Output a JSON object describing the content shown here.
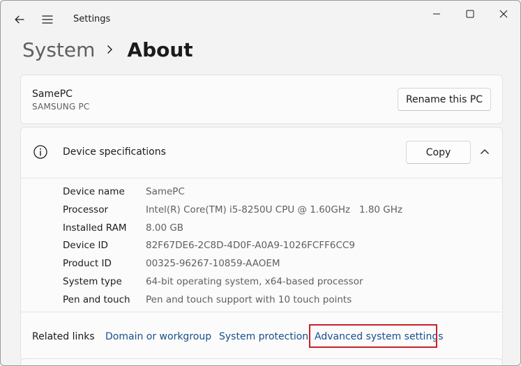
{
  "window": {
    "title": "Settings"
  },
  "breadcrumb": {
    "parent": "System",
    "current": "About"
  },
  "pc": {
    "name": "SamePC",
    "model": "SAMSUNG PC",
    "rename_label": "Rename this PC"
  },
  "specs": {
    "title": "Device specifications",
    "copy_label": "Copy",
    "rows": [
      {
        "label": "Device name",
        "value": "SamePC"
      },
      {
        "label": "Processor",
        "value": "Intel(R) Core(TM) i5-8250U CPU @ 1.60GHz   1.80 GHz"
      },
      {
        "label": "Installed RAM",
        "value": "8.00 GB"
      },
      {
        "label": "Device ID",
        "value": "82F67DE6-2C8D-4D0F-A0A9-1026FCFF6CC9"
      },
      {
        "label": "Product ID",
        "value": "00325-96267-10859-AAOEM"
      },
      {
        "label": "System type",
        "value": "64-bit operating system, x64-based processor"
      },
      {
        "label": "Pen and touch",
        "value": "Pen and touch support with 10 touch points"
      }
    ]
  },
  "related": {
    "label": "Related links",
    "links": [
      "Domain or workgroup",
      "System protection",
      "Advanced system settings"
    ]
  },
  "icons": {
    "back": "back-arrow-icon",
    "menu": "hamburger-menu-icon",
    "minimize": "minimize-icon",
    "maximize": "maximize-icon",
    "close": "close-icon",
    "separator": "chevron-right-icon",
    "info": "info-icon",
    "collapse": "chevron-up-icon"
  },
  "colors": {
    "link": "#1a4f8b",
    "highlight": "#c8202a"
  }
}
